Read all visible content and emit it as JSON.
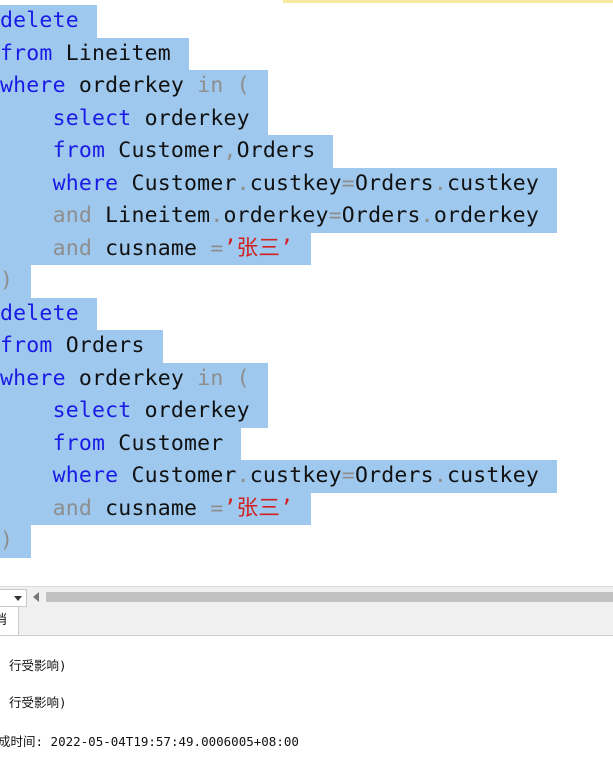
{
  "editor": {
    "lines": [
      [
        {
          "t": "delete",
          "c": "kw"
        }
      ],
      [
        {
          "t": "from",
          "c": "kw"
        },
        {
          "t": " Lineitem",
          "c": "id"
        }
      ],
      [
        {
          "t": "where",
          "c": "kw"
        },
        {
          "t": " orderkey ",
          "c": "id"
        },
        {
          "t": "in",
          "c": "op"
        },
        {
          "t": " (",
          "c": "op"
        }
      ],
      [
        {
          "t": "    ",
          "c": "id"
        },
        {
          "t": "select",
          "c": "kw"
        },
        {
          "t": " orderkey",
          "c": "id"
        }
      ],
      [
        {
          "t": "    ",
          "c": "id"
        },
        {
          "t": "from",
          "c": "kw"
        },
        {
          "t": " Customer",
          "c": "id"
        },
        {
          "t": ",",
          "c": "op"
        },
        {
          "t": "Orders",
          "c": "id"
        }
      ],
      [
        {
          "t": "    ",
          "c": "id"
        },
        {
          "t": "where",
          "c": "kw"
        },
        {
          "t": " Customer",
          "c": "id"
        },
        {
          "t": ".",
          "c": "op"
        },
        {
          "t": "custkey",
          "c": "id"
        },
        {
          "t": "=",
          "c": "op"
        },
        {
          "t": "Orders",
          "c": "id"
        },
        {
          "t": ".",
          "c": "op"
        },
        {
          "t": "custkey",
          "c": "id"
        }
      ],
      [
        {
          "t": "    ",
          "c": "id"
        },
        {
          "t": "and",
          "c": "op"
        },
        {
          "t": " Lineitem",
          "c": "id"
        },
        {
          "t": ".",
          "c": "op"
        },
        {
          "t": "orderkey",
          "c": "id"
        },
        {
          "t": "=",
          "c": "op"
        },
        {
          "t": "Orders",
          "c": "id"
        },
        {
          "t": ".",
          "c": "op"
        },
        {
          "t": "orderkey",
          "c": "id"
        }
      ],
      [
        {
          "t": "    ",
          "c": "id"
        },
        {
          "t": "and",
          "c": "op"
        },
        {
          "t": " cusname ",
          "c": "id"
        },
        {
          "t": "=",
          "c": "op"
        },
        {
          "t": "’张三’",
          "c": "str"
        }
      ],
      [
        {
          "t": ")",
          "c": "op"
        }
      ],
      [
        {
          "t": "delete",
          "c": "kw"
        }
      ],
      [
        {
          "t": "from",
          "c": "kw"
        },
        {
          "t": " Orders",
          "c": "id"
        }
      ],
      [
        {
          "t": "where",
          "c": "kw"
        },
        {
          "t": " orderkey ",
          "c": "id"
        },
        {
          "t": "in",
          "c": "op"
        },
        {
          "t": " (",
          "c": "op"
        }
      ],
      [
        {
          "t": "    ",
          "c": "id"
        },
        {
          "t": "select",
          "c": "kw"
        },
        {
          "t": " orderkey",
          "c": "id"
        }
      ],
      [
        {
          "t": "    ",
          "c": "id"
        },
        {
          "t": "from",
          "c": "kw"
        },
        {
          "t": " Customer",
          "c": "id"
        }
      ],
      [
        {
          "t": "    ",
          "c": "id"
        },
        {
          "t": "where",
          "c": "kw"
        },
        {
          "t": " Customer",
          "c": "id"
        },
        {
          "t": ".",
          "c": "op"
        },
        {
          "t": "custkey",
          "c": "id"
        },
        {
          "t": "=",
          "c": "op"
        },
        {
          "t": "Orders",
          "c": "id"
        },
        {
          "t": ".",
          "c": "op"
        },
        {
          "t": "custkey",
          "c": "id"
        }
      ],
      [
        {
          "t": "    ",
          "c": "id"
        },
        {
          "t": "and",
          "c": "op"
        },
        {
          "t": " cusname ",
          "c": "id"
        },
        {
          "t": "=",
          "c": "op"
        },
        {
          "t": "’张三’",
          "c": "str"
        }
      ],
      [
        {
          "t": ")",
          "c": "op"
        }
      ]
    ]
  },
  "results": {
    "tab_label": "消息",
    "messages": [
      "行受影响)",
      "行受影响)",
      "成时间: 2022-05-04T19:57:49.0006005+08:00"
    ]
  },
  "colors": {
    "keyword": "#1a1ae6",
    "operator": "#8e8e8e",
    "string": "#d21f1f",
    "selection": "#9ec8ee"
  }
}
